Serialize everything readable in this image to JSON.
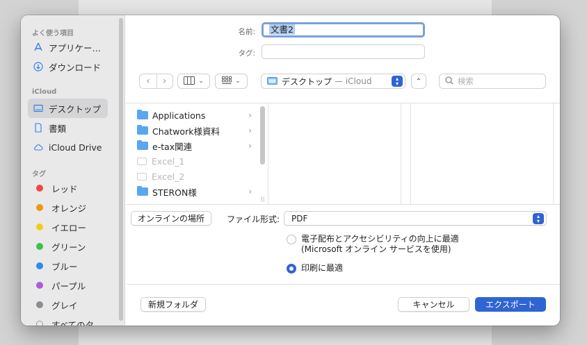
{
  "sidebar": {
    "favorites_header": "よく使う項目",
    "favorites": [
      {
        "label": "アプリケー…",
        "icon": "applications-icon"
      },
      {
        "label": "ダウンロード",
        "icon": "download-icon"
      }
    ],
    "icloud_header": "iCloud",
    "icloud": [
      {
        "label": "デスクトップ",
        "icon": "desktop-icon",
        "selected": true
      },
      {
        "label": "書類",
        "icon": "document-icon"
      },
      {
        "label": "iCloud Drive",
        "icon": "cloud-icon"
      }
    ],
    "tags_header": "タグ",
    "tags": [
      {
        "label": "レッド",
        "color": "#f0473f"
      },
      {
        "label": "オレンジ",
        "color": "#f0960e"
      },
      {
        "label": "イエロー",
        "color": "#f5cb1b"
      },
      {
        "label": "グリーン",
        "color": "#3fc04a"
      },
      {
        "label": "ブルー",
        "color": "#2f88f0"
      },
      {
        "label": "パープル",
        "color": "#b05ad8"
      },
      {
        "label": "グレイ",
        "color": "#8d8d90"
      },
      {
        "label": "すべてのタ…",
        "color": "#c8c8c8"
      }
    ]
  },
  "form": {
    "name_label": "名前:",
    "name_value": "文書2",
    "tag_label": "タグ:"
  },
  "toolbar": {
    "back": "‹",
    "forward": "›",
    "location": "デスクトップ",
    "location_sub": "— iCloud",
    "search_placeholder": "検索"
  },
  "browser": {
    "items": [
      {
        "label": "Applications",
        "type": "folder",
        "expandable": true
      },
      {
        "label": "Chatwork様資料",
        "type": "folder",
        "expandable": true
      },
      {
        "label": "e-tax関連",
        "type": "folder",
        "expandable": true
      },
      {
        "label": "Excel_1",
        "type": "file",
        "expandable": false
      },
      {
        "label": "Excel_2",
        "type": "file",
        "expandable": false
      },
      {
        "label": "STERON様",
        "type": "folder",
        "expandable": true
      }
    ]
  },
  "options": {
    "online_button": "オンラインの場所",
    "format_label": "ファイル形式:",
    "format_value": "PDF",
    "radio1_line1": "電子配布とアクセシビリティの向上に最適",
    "radio1_line2": "(Microsoft オンライン サービスを使用)",
    "radio2": "印刷に最適"
  },
  "footer": {
    "new_folder": "新規フォルダ",
    "cancel": "キャンセル",
    "export": "エクスポート"
  }
}
